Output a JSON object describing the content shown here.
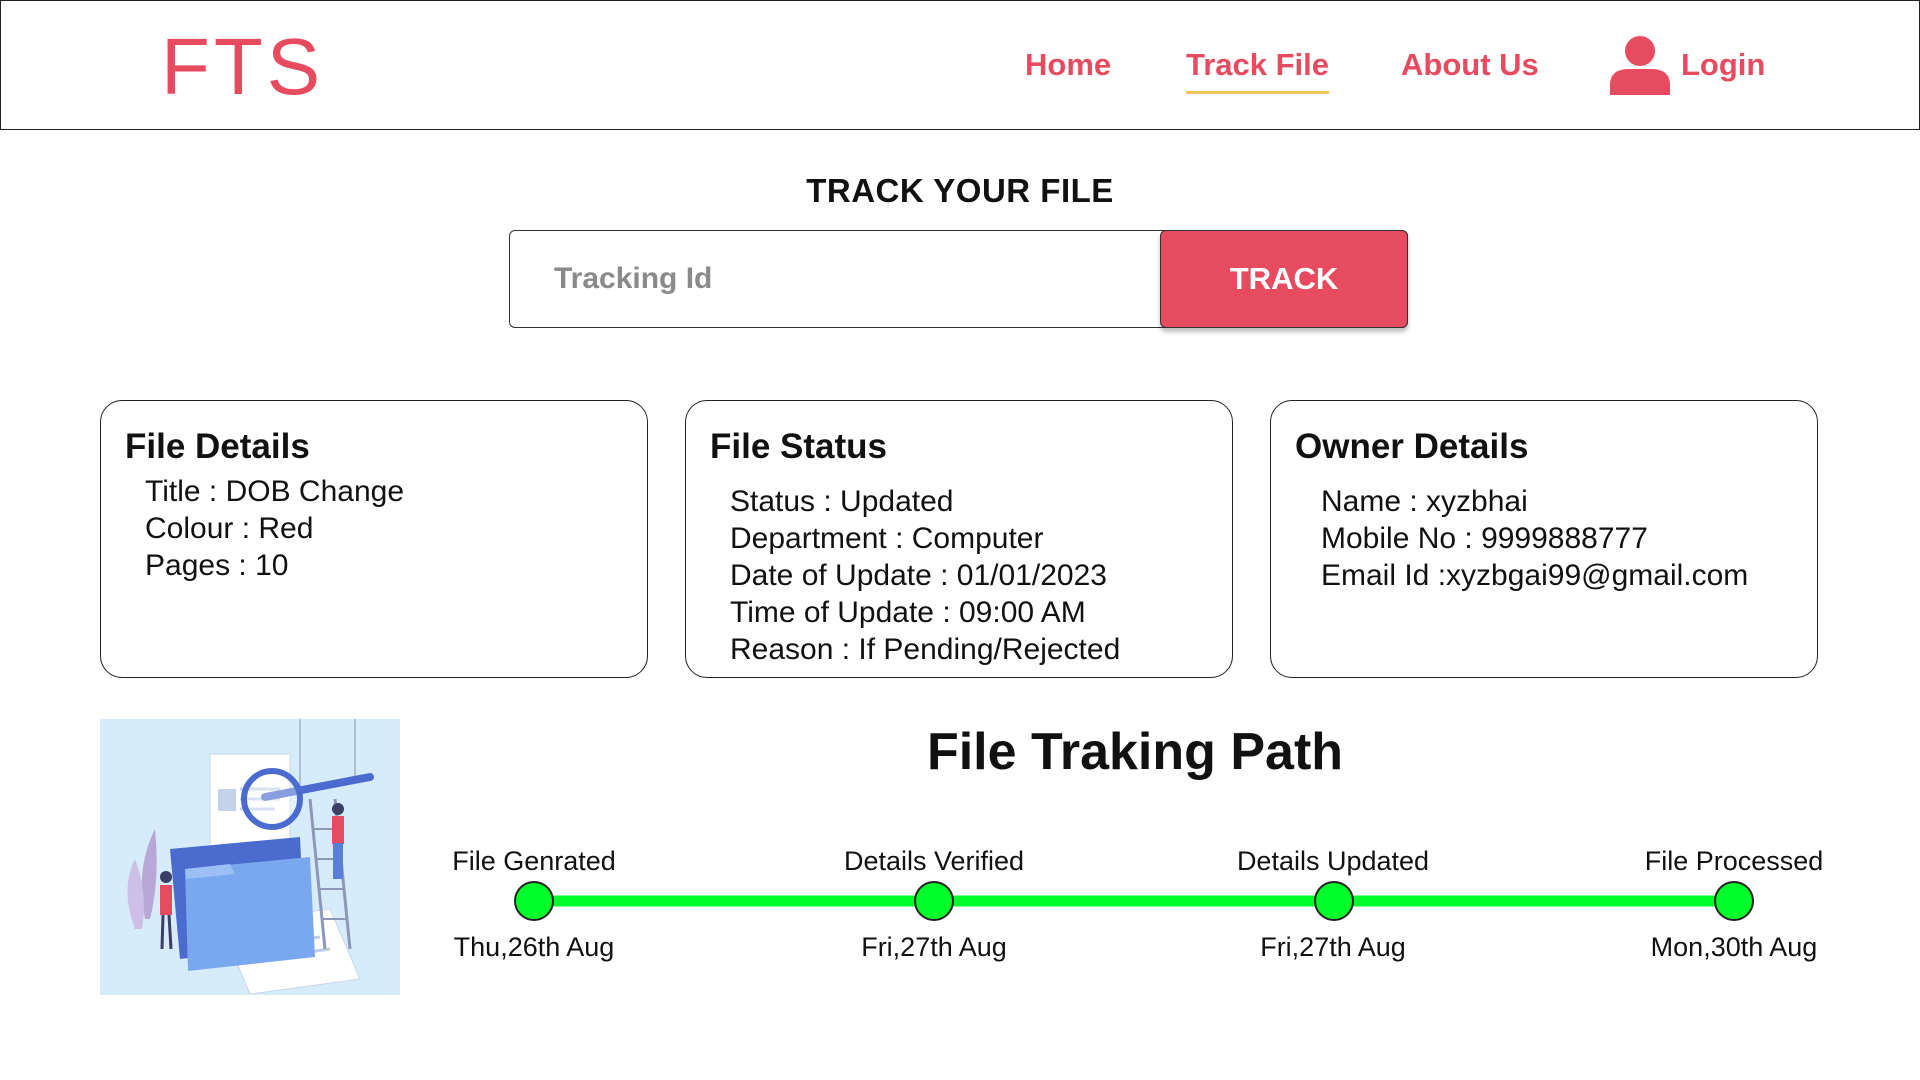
{
  "header": {
    "logo": "FTS",
    "nav": {
      "home": "Home",
      "track_file": "Track File",
      "about": "About Us",
      "login": "Login"
    },
    "accent_color": "#e74b5f",
    "active_underline_color": "#f4c45a"
  },
  "track": {
    "title": "TRACK YOUR FILE",
    "input_placeholder": "Tracking Id",
    "button_label": "TRACK"
  },
  "file_details": {
    "heading": "File Details",
    "rows": [
      "Title : DOB Change",
      "Colour : Red",
      "Pages  : 10"
    ]
  },
  "file_status": {
    "heading": "File Status",
    "rows": [
      "Status : Updated",
      "Department : Computer",
      "Date of Update  : 01/01/2023",
      "Time of Update  : 09:00 AM",
      "Reason  : If Pending/Rejected"
    ]
  },
  "owner_details": {
    "heading": "Owner Details",
    "rows": [
      "Name : xyzbhai",
      "Mobile No  : 9999888777",
      "Email Id :xyzbgai99@gmail.com"
    ]
  },
  "tracking_path": {
    "title": "File Traking Path",
    "line_color": "#00ff2a",
    "stages": [
      {
        "label": "File Genrated",
        "date": "Thu,26th Aug"
      },
      {
        "label": "Details Verified",
        "date": "Fri,27th Aug"
      },
      {
        "label": "Details Updated",
        "date": "Fri,27th Aug"
      },
      {
        "label": "File Processed",
        "date": "Mon,30th Aug"
      }
    ]
  },
  "illustration": {
    "icon": "file-search-illustration",
    "background": "#d6ecfb"
  }
}
